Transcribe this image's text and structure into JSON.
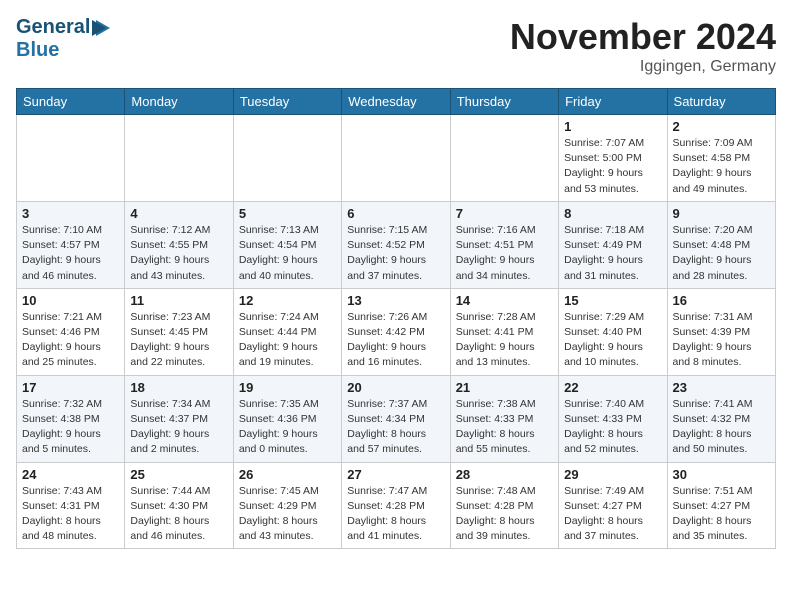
{
  "logo": {
    "line1": "General",
    "line2": "Blue"
  },
  "title": "November 2024",
  "location": "Iggingen, Germany",
  "days_of_week": [
    "Sunday",
    "Monday",
    "Tuesday",
    "Wednesday",
    "Thursday",
    "Friday",
    "Saturday"
  ],
  "weeks": [
    [
      {
        "day": "",
        "sunrise": "",
        "sunset": "",
        "daylight": ""
      },
      {
        "day": "",
        "sunrise": "",
        "sunset": "",
        "daylight": ""
      },
      {
        "day": "",
        "sunrise": "",
        "sunset": "",
        "daylight": ""
      },
      {
        "day": "",
        "sunrise": "",
        "sunset": "",
        "daylight": ""
      },
      {
        "day": "",
        "sunrise": "",
        "sunset": "",
        "daylight": ""
      },
      {
        "day": "1",
        "sunrise": "Sunrise: 7:07 AM",
        "sunset": "Sunset: 5:00 PM",
        "daylight": "Daylight: 9 hours and 53 minutes."
      },
      {
        "day": "2",
        "sunrise": "Sunrise: 7:09 AM",
        "sunset": "Sunset: 4:58 PM",
        "daylight": "Daylight: 9 hours and 49 minutes."
      }
    ],
    [
      {
        "day": "3",
        "sunrise": "Sunrise: 7:10 AM",
        "sunset": "Sunset: 4:57 PM",
        "daylight": "Daylight: 9 hours and 46 minutes."
      },
      {
        "day": "4",
        "sunrise": "Sunrise: 7:12 AM",
        "sunset": "Sunset: 4:55 PM",
        "daylight": "Daylight: 9 hours and 43 minutes."
      },
      {
        "day": "5",
        "sunrise": "Sunrise: 7:13 AM",
        "sunset": "Sunset: 4:54 PM",
        "daylight": "Daylight: 9 hours and 40 minutes."
      },
      {
        "day": "6",
        "sunrise": "Sunrise: 7:15 AM",
        "sunset": "Sunset: 4:52 PM",
        "daylight": "Daylight: 9 hours and 37 minutes."
      },
      {
        "day": "7",
        "sunrise": "Sunrise: 7:16 AM",
        "sunset": "Sunset: 4:51 PM",
        "daylight": "Daylight: 9 hours and 34 minutes."
      },
      {
        "day": "8",
        "sunrise": "Sunrise: 7:18 AM",
        "sunset": "Sunset: 4:49 PM",
        "daylight": "Daylight: 9 hours and 31 minutes."
      },
      {
        "day": "9",
        "sunrise": "Sunrise: 7:20 AM",
        "sunset": "Sunset: 4:48 PM",
        "daylight": "Daylight: 9 hours and 28 minutes."
      }
    ],
    [
      {
        "day": "10",
        "sunrise": "Sunrise: 7:21 AM",
        "sunset": "Sunset: 4:46 PM",
        "daylight": "Daylight: 9 hours and 25 minutes."
      },
      {
        "day": "11",
        "sunrise": "Sunrise: 7:23 AM",
        "sunset": "Sunset: 4:45 PM",
        "daylight": "Daylight: 9 hours and 22 minutes."
      },
      {
        "day": "12",
        "sunrise": "Sunrise: 7:24 AM",
        "sunset": "Sunset: 4:44 PM",
        "daylight": "Daylight: 9 hours and 19 minutes."
      },
      {
        "day": "13",
        "sunrise": "Sunrise: 7:26 AM",
        "sunset": "Sunset: 4:42 PM",
        "daylight": "Daylight: 9 hours and 16 minutes."
      },
      {
        "day": "14",
        "sunrise": "Sunrise: 7:28 AM",
        "sunset": "Sunset: 4:41 PM",
        "daylight": "Daylight: 9 hours and 13 minutes."
      },
      {
        "day": "15",
        "sunrise": "Sunrise: 7:29 AM",
        "sunset": "Sunset: 4:40 PM",
        "daylight": "Daylight: 9 hours and 10 minutes."
      },
      {
        "day": "16",
        "sunrise": "Sunrise: 7:31 AM",
        "sunset": "Sunset: 4:39 PM",
        "daylight": "Daylight: 9 hours and 8 minutes."
      }
    ],
    [
      {
        "day": "17",
        "sunrise": "Sunrise: 7:32 AM",
        "sunset": "Sunset: 4:38 PM",
        "daylight": "Daylight: 9 hours and 5 minutes."
      },
      {
        "day": "18",
        "sunrise": "Sunrise: 7:34 AM",
        "sunset": "Sunset: 4:37 PM",
        "daylight": "Daylight: 9 hours and 2 minutes."
      },
      {
        "day": "19",
        "sunrise": "Sunrise: 7:35 AM",
        "sunset": "Sunset: 4:36 PM",
        "daylight": "Daylight: 9 hours and 0 minutes."
      },
      {
        "day": "20",
        "sunrise": "Sunrise: 7:37 AM",
        "sunset": "Sunset: 4:34 PM",
        "daylight": "Daylight: 8 hours and 57 minutes."
      },
      {
        "day": "21",
        "sunrise": "Sunrise: 7:38 AM",
        "sunset": "Sunset: 4:33 PM",
        "daylight": "Daylight: 8 hours and 55 minutes."
      },
      {
        "day": "22",
        "sunrise": "Sunrise: 7:40 AM",
        "sunset": "Sunset: 4:33 PM",
        "daylight": "Daylight: 8 hours and 52 minutes."
      },
      {
        "day": "23",
        "sunrise": "Sunrise: 7:41 AM",
        "sunset": "Sunset: 4:32 PM",
        "daylight": "Daylight: 8 hours and 50 minutes."
      }
    ],
    [
      {
        "day": "24",
        "sunrise": "Sunrise: 7:43 AM",
        "sunset": "Sunset: 4:31 PM",
        "daylight": "Daylight: 8 hours and 48 minutes."
      },
      {
        "day": "25",
        "sunrise": "Sunrise: 7:44 AM",
        "sunset": "Sunset: 4:30 PM",
        "daylight": "Daylight: 8 hours and 46 minutes."
      },
      {
        "day": "26",
        "sunrise": "Sunrise: 7:45 AM",
        "sunset": "Sunset: 4:29 PM",
        "daylight": "Daylight: 8 hours and 43 minutes."
      },
      {
        "day": "27",
        "sunrise": "Sunrise: 7:47 AM",
        "sunset": "Sunset: 4:28 PM",
        "daylight": "Daylight: 8 hours and 41 minutes."
      },
      {
        "day": "28",
        "sunrise": "Sunrise: 7:48 AM",
        "sunset": "Sunset: 4:28 PM",
        "daylight": "Daylight: 8 hours and 39 minutes."
      },
      {
        "day": "29",
        "sunrise": "Sunrise: 7:49 AM",
        "sunset": "Sunset: 4:27 PM",
        "daylight": "Daylight: 8 hours and 37 minutes."
      },
      {
        "day": "30",
        "sunrise": "Sunrise: 7:51 AM",
        "sunset": "Sunset: 4:27 PM",
        "daylight": "Daylight: 8 hours and 35 minutes."
      }
    ]
  ]
}
